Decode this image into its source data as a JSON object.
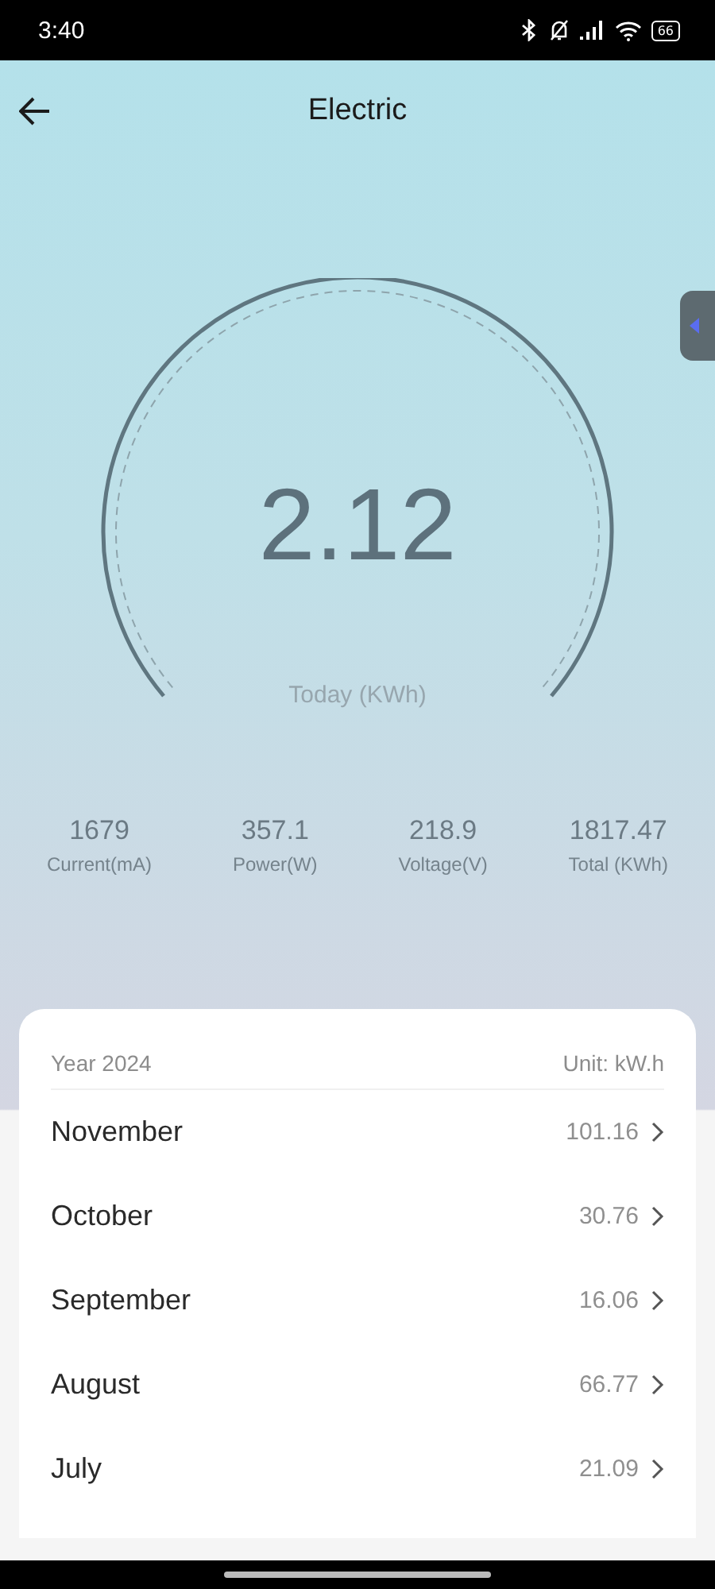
{
  "status_bar": {
    "time": "3:40",
    "battery": "66"
  },
  "header": {
    "title": "Electric"
  },
  "gauge": {
    "value": "2.12",
    "label": "Today (KWh)"
  },
  "stats": [
    {
      "value": "1679",
      "label": "Current(mA)"
    },
    {
      "value": "357.1",
      "label": "Power(W)"
    },
    {
      "value": "218.9",
      "label": "Voltage(V)"
    },
    {
      "value": "1817.47",
      "label": "Total (KWh)"
    }
  ],
  "history": {
    "year": "Year 2024",
    "unit": "Unit: kW.h",
    "months": [
      {
        "name": "November",
        "value": "101.16"
      },
      {
        "name": "October",
        "value": "30.76"
      },
      {
        "name": "September",
        "value": "16.06"
      },
      {
        "name": "August",
        "value": "66.77"
      },
      {
        "name": "July",
        "value": "21.09"
      }
    ]
  }
}
